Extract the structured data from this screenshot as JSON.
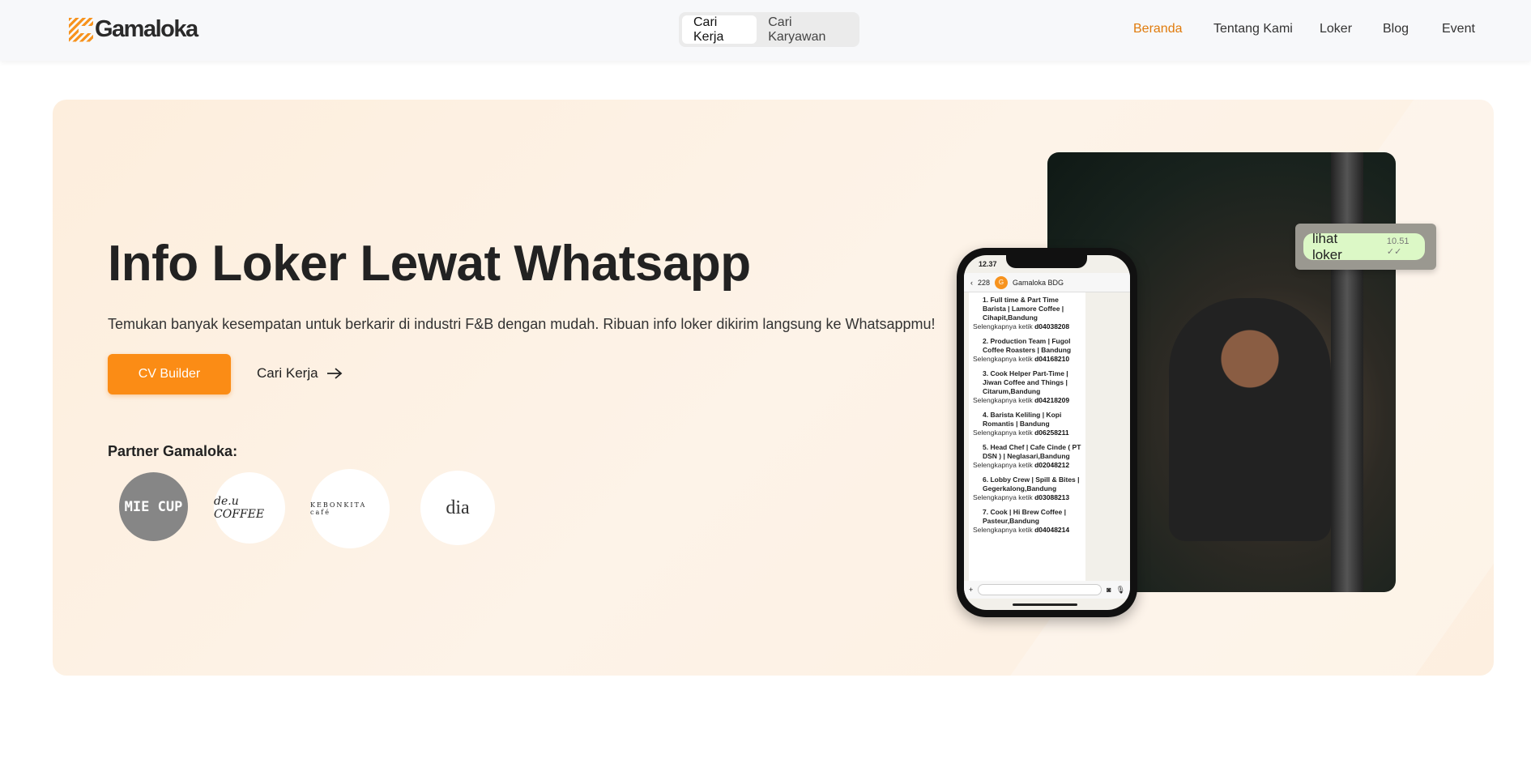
{
  "header": {
    "logo": "Gamaloka",
    "toggle": [
      "Cari Kerja",
      "Cari Karyawan"
    ],
    "nav": [
      "Beranda",
      "Tentang Kami",
      "Loker",
      "Blog",
      "Event"
    ],
    "accent": "#e07b0c"
  },
  "hero": {
    "title": "Info Loker Lewat Whatsapp",
    "subtitle": "Temukan banyak kesempatan untuk berkarir di industri F&B dengan mudah. Ribuan info loker dikirim langsung ke Whatsappmu!",
    "cv_button": "CV Builder",
    "cari_link": "Cari Kerja",
    "partner_label": "Partner Gamaloka:",
    "partners": [
      "MIE CUP",
      "de.u COFFEE",
      "KEBONKITA café",
      "dia"
    ]
  },
  "phone": {
    "time": "12.37",
    "back_count": "228",
    "chat_name": "Gamaloka BDG",
    "prefix": "Selengkapnya ketik",
    "jobs": [
      {
        "title": "1. Full time & Part Time Barista | Lamore Coffee | Cihapit,Bandung",
        "code": "d04038208"
      },
      {
        "title": "2. Production Team | Fugol Coffee Roasters | Bandung",
        "code": "d04168210"
      },
      {
        "title": "3. Cook Helper Part-Time | Jiwan Coffee and Things | Citarum,Bandung",
        "code": "d04218209"
      },
      {
        "title": "4. Barista Keliling | Kopi Romantis | Bandung",
        "code": "d06258211"
      },
      {
        "title": "5. Head Chef | Cafe Cinde ( PT DSN ) | Neglasari,Bandung",
        "code": "d02048212"
      },
      {
        "title": "6. Lobby Crew | Spill & Bites | Gegerkalong,Bandung",
        "code": "d03088213"
      },
      {
        "title": "7. Cook | Hi Brew Coffee | Pasteur,Bandung",
        "code": "d04048214"
      }
    ]
  },
  "bubble": {
    "text": "lihat loker",
    "time": "10.51 ✓✓"
  }
}
